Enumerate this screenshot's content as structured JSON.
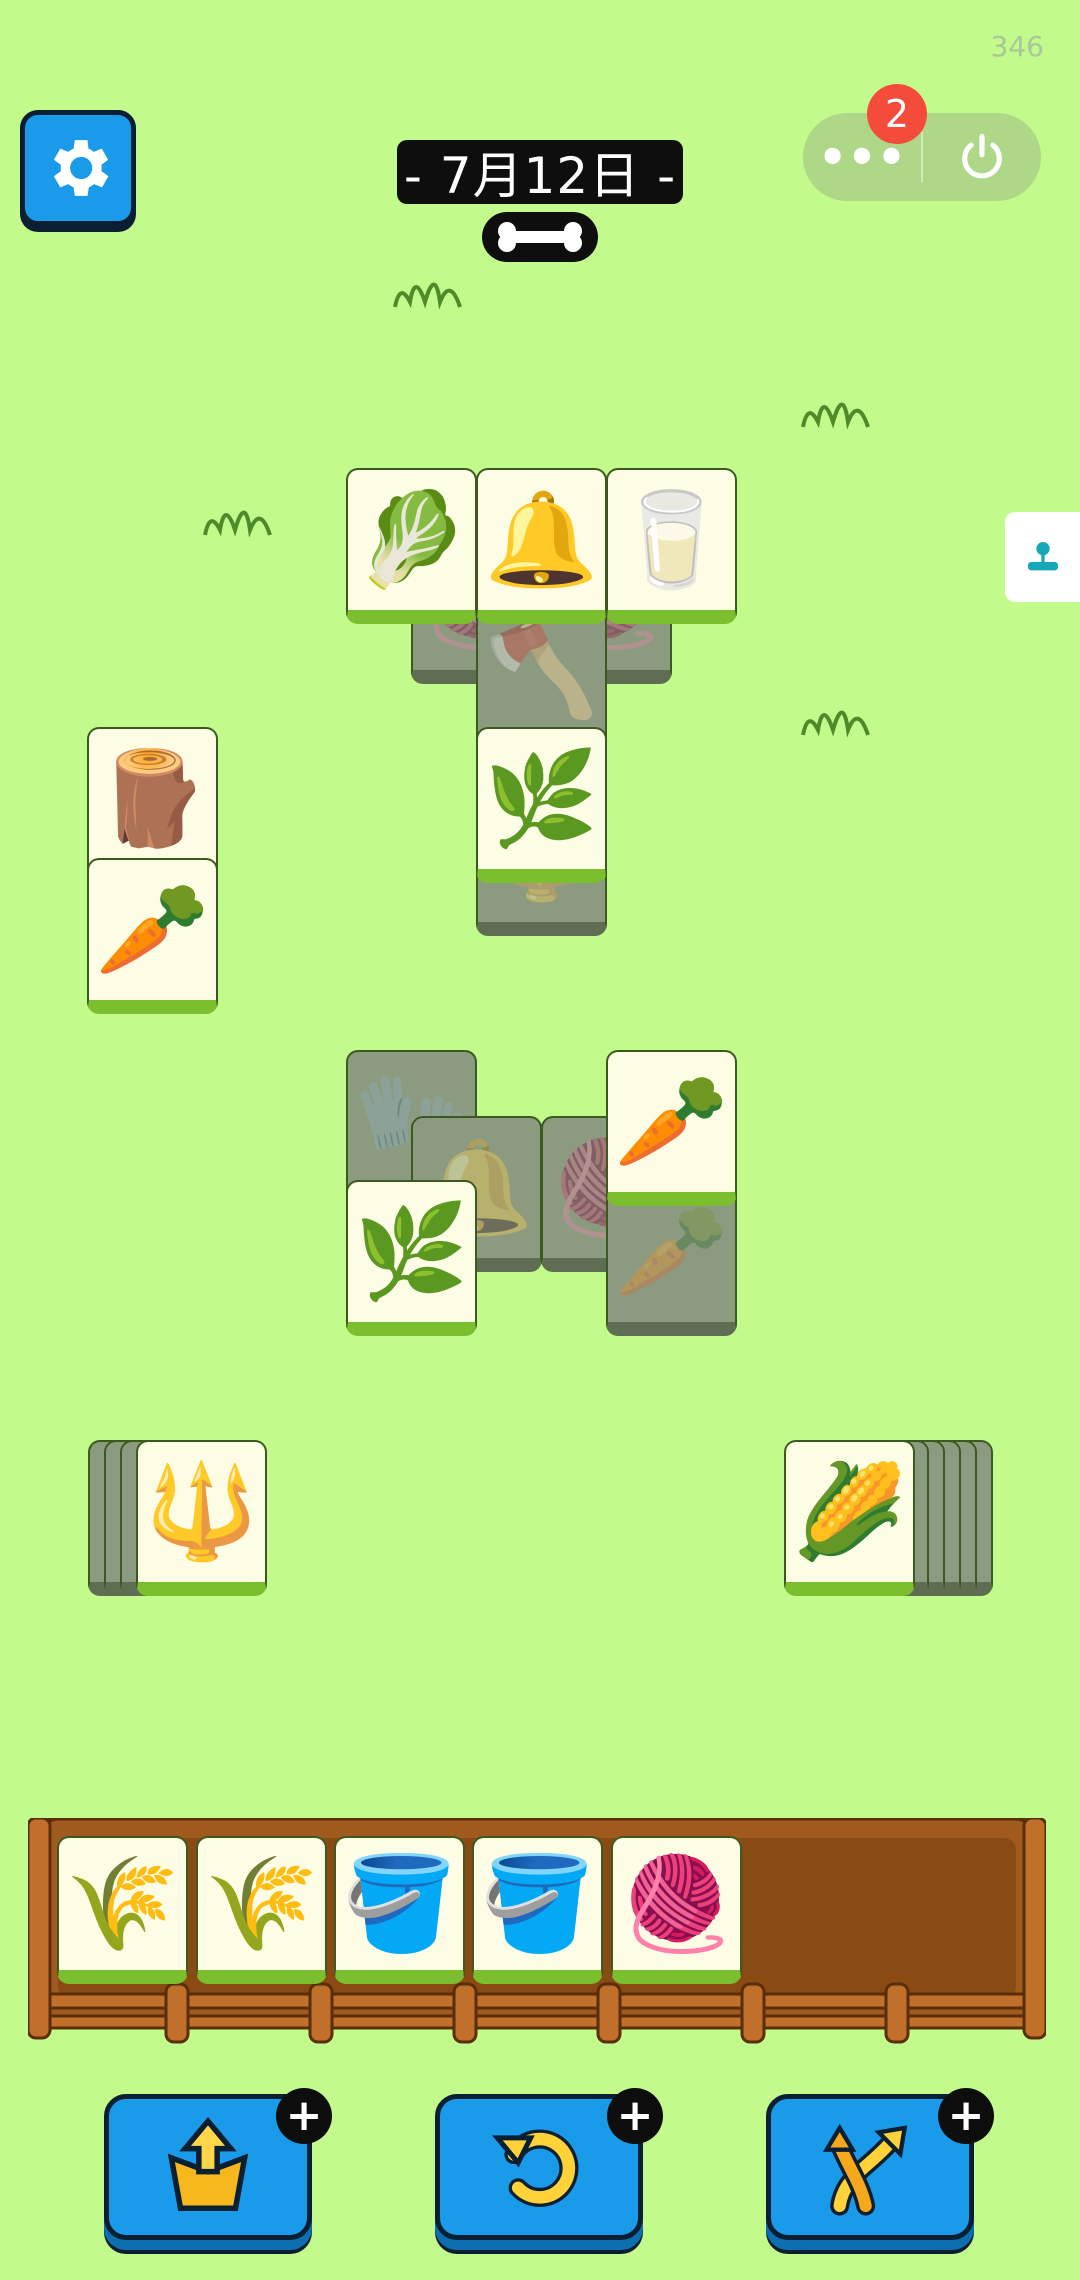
{
  "header": {
    "counter": "346",
    "date": "- 7月12日 -",
    "notification_count": "2",
    "menu_label": "•••"
  },
  "board": {
    "tiles": [
      {
        "name": "cabbage-tile",
        "icon": "cabbage-icon",
        "glyph": "🥬",
        "state": "active"
      },
      {
        "name": "bell-tile",
        "icon": "bell-icon",
        "glyph": "🔔",
        "state": "active"
      },
      {
        "name": "milk-jar-tile",
        "icon": "milk-jar-icon",
        "glyph": "🥛",
        "state": "active"
      },
      {
        "name": "grass-tile",
        "icon": "grass-icon",
        "glyph": "🌿",
        "state": "active"
      },
      {
        "name": "stump-tile",
        "icon": "tree-stump-icon",
        "glyph": "🪵",
        "state": "active"
      },
      {
        "name": "carrot-tile",
        "icon": "carrot-icon",
        "glyph": "🥕",
        "state": "active"
      },
      {
        "name": "carrot-tile-2",
        "icon": "carrot-icon",
        "glyph": "🥕",
        "state": "active"
      },
      {
        "name": "grass-tile-2",
        "icon": "grass-icon",
        "glyph": "🌿",
        "state": "active"
      },
      {
        "name": "pitchfork-tile",
        "icon": "pitchfork-icon",
        "glyph": "🔱",
        "state": "active"
      },
      {
        "name": "corn-tile",
        "icon": "corn-icon",
        "glyph": "🌽",
        "state": "active"
      }
    ],
    "covered_tiles": [
      {
        "name": "wool-tile-covered",
        "icon": "wool-icon",
        "glyph": "🧶"
      },
      {
        "name": "wool-tile-covered-2",
        "icon": "wool-icon",
        "glyph": "🧶"
      },
      {
        "name": "shovel-tile-covered",
        "icon": "shovel-icon",
        "glyph": "🪓"
      },
      {
        "name": "pitchfork-tile-covered",
        "icon": "pitchfork-icon",
        "glyph": "🔱"
      },
      {
        "name": "glove-tile-covered",
        "icon": "glove-icon",
        "glyph": "🧤"
      },
      {
        "name": "bell-tile-covered",
        "icon": "bell-icon",
        "glyph": "🔔"
      },
      {
        "name": "wool-tile-covered-3",
        "icon": "wool-icon",
        "glyph": "🧶"
      },
      {
        "name": "carrot-tile-covered",
        "icon": "carrot-icon",
        "glyph": "🥕"
      }
    ]
  },
  "tray": {
    "capacity": 7,
    "slots": [
      {
        "icon": "wheat-icon",
        "glyph": "🌾"
      },
      {
        "icon": "wheat-icon",
        "glyph": "🌾"
      },
      {
        "icon": "bucket-icon",
        "glyph": "🪣"
      },
      {
        "icon": "bucket-icon",
        "glyph": "🪣"
      },
      {
        "icon": "yarn-icon",
        "glyph": "🧶"
      }
    ]
  },
  "tools": [
    {
      "name": "move-out-button",
      "icon": "move-out-icon"
    },
    {
      "name": "undo-button",
      "icon": "undo-icon"
    },
    {
      "name": "shuffle-button",
      "icon": "shuffle-icon"
    }
  ],
  "colors": {
    "background": "#c2fb8b",
    "button_blue": "#1a9bea",
    "tile_face": "#fdfde6",
    "tile_edge": "#7bbe2e",
    "badge_red": "#f54b3b",
    "fence_brown": "#a05a1e"
  }
}
